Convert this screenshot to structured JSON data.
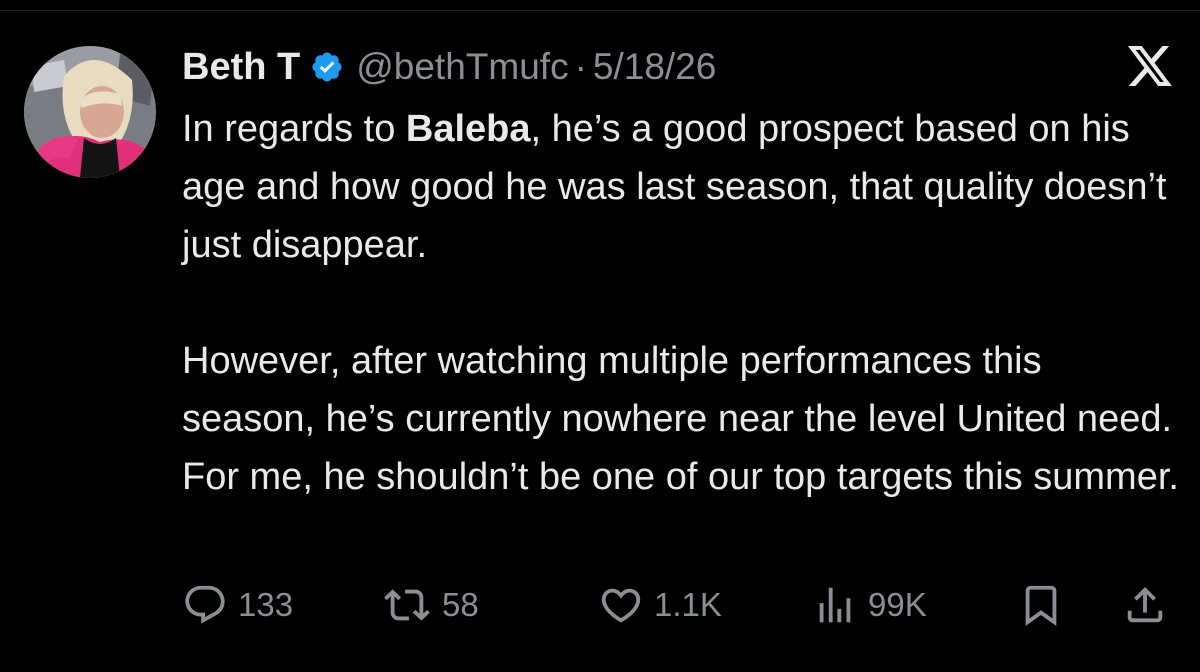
{
  "author": {
    "display_name": "Beth T",
    "handle": "@bethTmufc",
    "separator": "·",
    "date": "5/18/26",
    "verified": true
  },
  "tweet": {
    "paragraph1_before": "In regards to ",
    "paragraph1_bold": "Baleba",
    "paragraph1_after": ", he’s a good prospect based on his age and how good he was last season, that quality doesn’t just disappear.",
    "paragraph2": "However, after watching multiple performances this season, he’s currently nowhere near the level United need. For me, he shouldn’t be one of our top targets this summer."
  },
  "actions": {
    "replies": "133",
    "reposts": "58",
    "likes": "1.1K",
    "views": "99K"
  },
  "icons": {
    "reply": "speech-bubble-icon",
    "repost": "repost-arrows-icon",
    "like": "heart-icon",
    "views": "bar-chart-icon",
    "bookmark": "bookmark-icon",
    "share": "share-upload-icon",
    "brand": "x-logo-icon",
    "verified": "verified-badge-icon"
  },
  "colors": {
    "background": "#000000",
    "text": "#e7e9ea",
    "secondary_text": "#8b8f94",
    "verified_blue": "#1d9bf0"
  }
}
